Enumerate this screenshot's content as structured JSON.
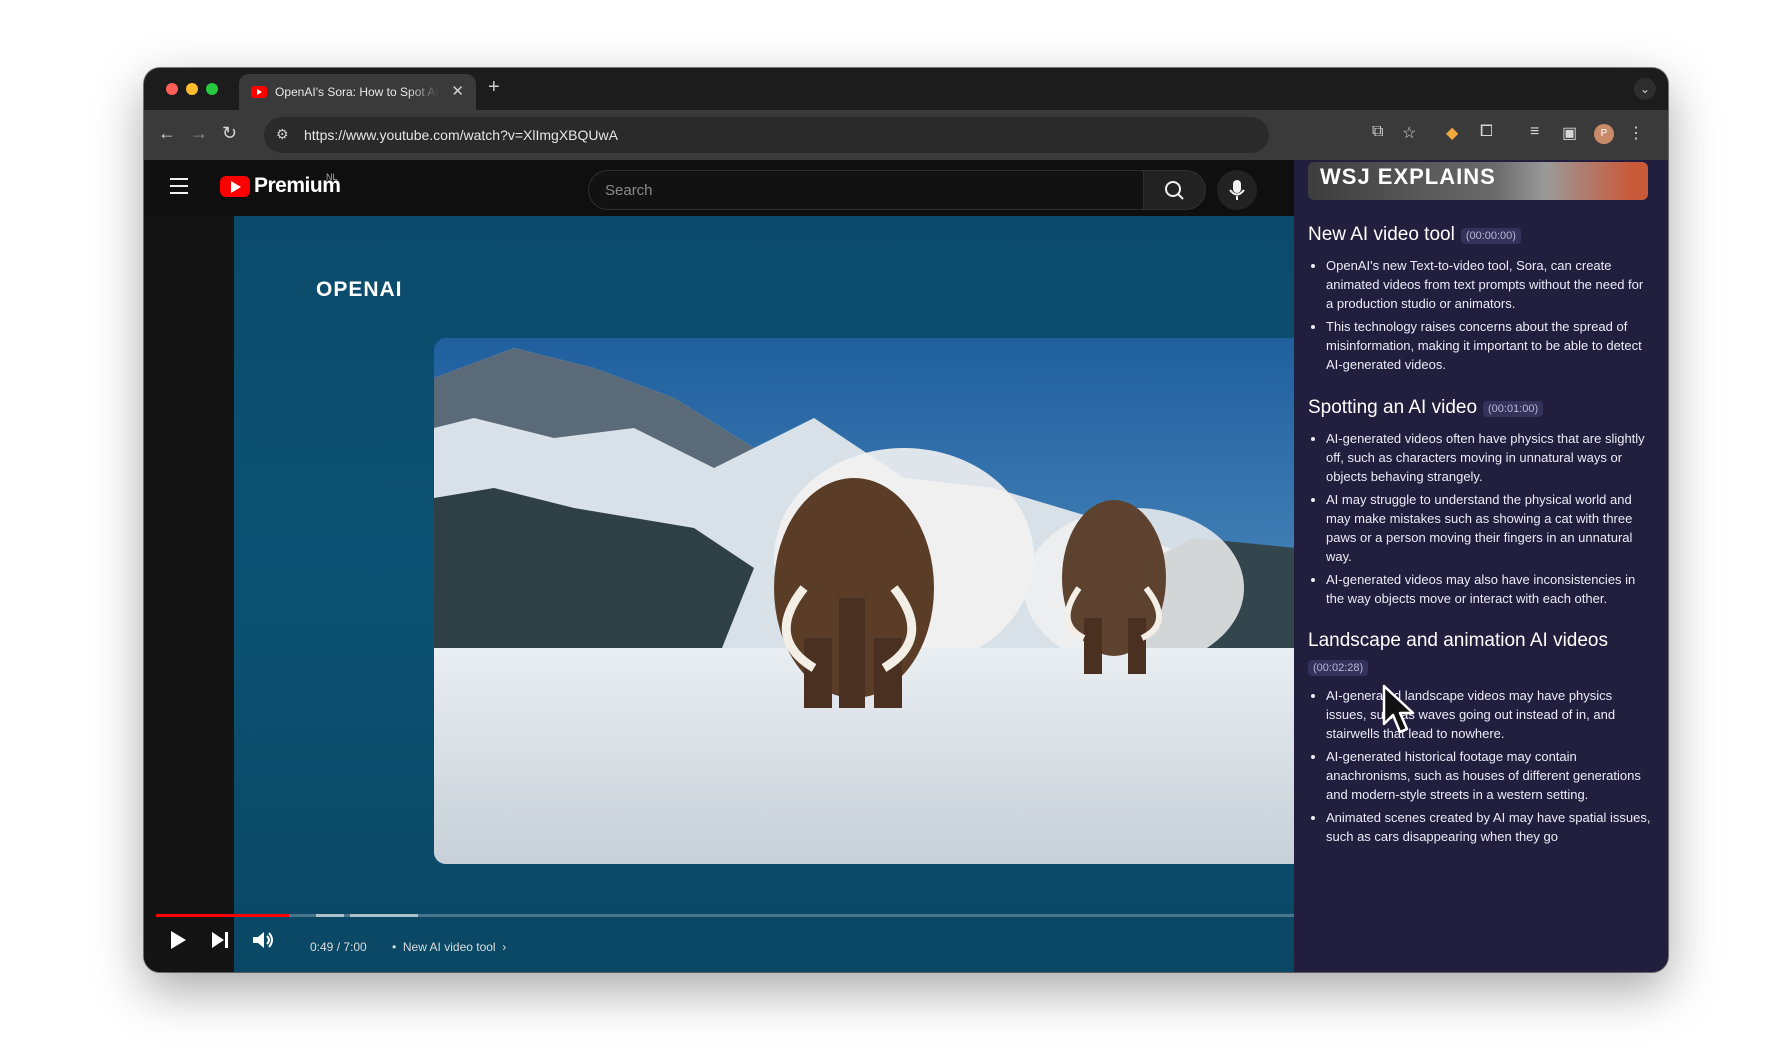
{
  "browser": {
    "tab": {
      "title": "OpenAI's Sora: How to Spot AI-Generated Videos",
      "close": "✕"
    },
    "new_tab": "+",
    "url": "https://www.youtube.com/watch?v=XlImgXBQUwA"
  },
  "youtube": {
    "logo_text": "Premium",
    "country": "NL",
    "search_placeholder": "Search"
  },
  "player": {
    "channel_logo": "OPENAI",
    "time": "0:49 / 7:00",
    "chapter": "New AI video tool",
    "progress_fraction": 0.117
  },
  "panel": {
    "banner": "WSJ EXPLAINS",
    "sections": [
      {
        "title": "New AI video tool",
        "timestamp": "(00:00:00)",
        "bullets": [
          "OpenAI's new Text-to-video tool, Sora, can create animated videos from text prompts without the need for a production studio or animators.",
          "This technology raises concerns about the spread of misinformation, making it important to be able to detect AI-generated videos."
        ]
      },
      {
        "title": "Spotting an AI video",
        "timestamp": "(00:01:00)",
        "bullets": [
          "AI-generated videos often have physics that are slightly off, such as characters moving in unnatural ways or objects behaving strangely.",
          "AI may struggle to understand the physical world and may make mistakes such as showing a cat with three paws or a person moving their fingers in an unnatural way.",
          "AI-generated videos may also have inconsistencies in the way objects move or interact with each other."
        ]
      },
      {
        "title": "Landscape and animation AI videos",
        "timestamp": "(00:02:28)",
        "bullets": [
          "AI-generated landscape videos may have physics issues, such as waves going out instead of in, and stairwells that lead to nowhere.",
          "AI-generated historical footage may contain anachronisms, such as houses of different generations and modern-style streets in a western setting.",
          "Animated scenes created by AI may have spatial issues, such as cars disappearing when they go"
        ]
      }
    ]
  },
  "colors": {
    "yt_red": "#ff0000",
    "panel_bg": "#211f3d",
    "video_bg": "#0d5274"
  }
}
